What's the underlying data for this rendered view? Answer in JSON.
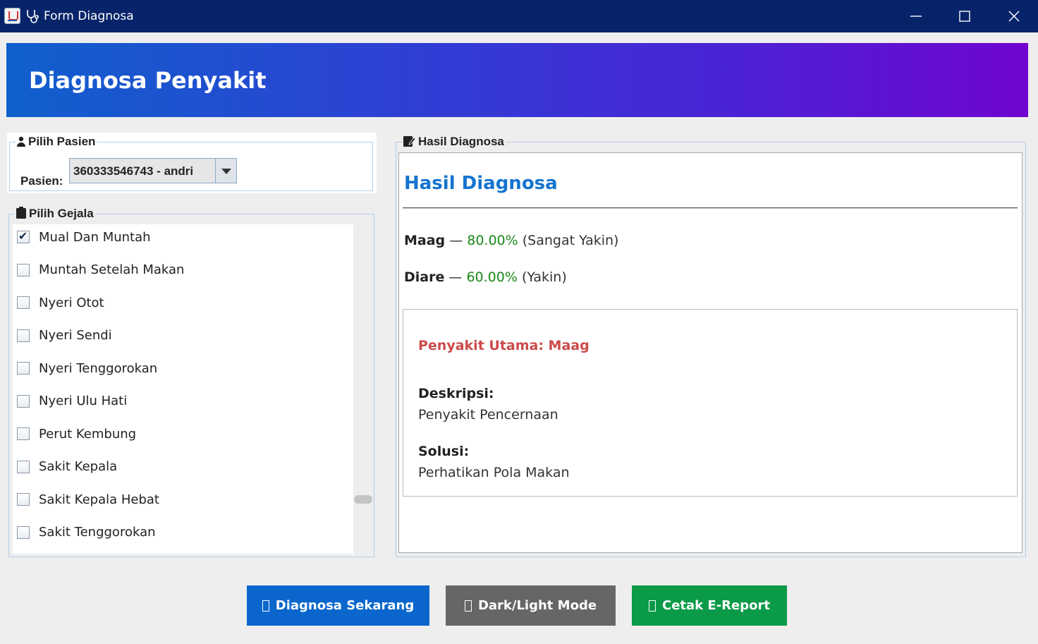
{
  "window": {
    "title": "Form Diagnosa",
    "icons": [
      "java-app-icon",
      "stethoscope-icon"
    ],
    "controls": [
      "minimize-icon",
      "maximize-icon",
      "close-icon"
    ]
  },
  "header": {
    "title": "Diagnosa Penyakit"
  },
  "pasien": {
    "group_title": "Pilih Pasien",
    "label": "Pasien:",
    "selected": "360333546743 - andri",
    "icon": "person-icon"
  },
  "gejala": {
    "group_title": "Pilih Gejala",
    "icon": "clipboard-icon",
    "items": [
      {
        "label": "Mual Dan Muntah",
        "checked": true
      },
      {
        "label": "Muntah Setelah Makan",
        "checked": false
      },
      {
        "label": "Nyeri Otot",
        "checked": false
      },
      {
        "label": "Nyeri Sendi",
        "checked": false
      },
      {
        "label": "Nyeri Tenggorokan",
        "checked": false
      },
      {
        "label": "Nyeri Ulu Hati",
        "checked": false
      },
      {
        "label": "Perut Kembung",
        "checked": false
      },
      {
        "label": "Sakit Kepala",
        "checked": false
      },
      {
        "label": "Sakit Kepala Hebat",
        "checked": false
      },
      {
        "label": "Sakit Tenggorokan",
        "checked": false
      }
    ]
  },
  "hasil": {
    "group_title": "Hasil Diagnosa",
    "icon": "notepad-icon",
    "heading": "Hasil Diagnosa",
    "results": [
      {
        "name": "Maag",
        "sep": " — ",
        "pct": "80.00%",
        "level": " (Sangat Yakin)"
      },
      {
        "name": "Diare",
        "sep": " — ",
        "pct": "60.00%",
        "level": " (Yakin)"
      }
    ],
    "utama": "Penyakit Utama: Maag",
    "deskripsi_label": "Deskripsi:",
    "deskripsi": "Penyakit Pencernaan",
    "solusi_label": "Solusi:",
    "solusi": "Perhatikan Pola Makan"
  },
  "buttons": {
    "diagnosa": "Diagnosa Sekarang",
    "mode": "Dark/Light Mode",
    "cetak": "Cetak E-Report"
  },
  "colors": {
    "titlebar": "#072369",
    "accent_blue": "#0a66cc",
    "mode_gray": "#666666",
    "cetak_green": "#0a9a48",
    "percent_green": "#1a8a1a",
    "utama_red": "#cc4a4a",
    "heading_blue": "#1574cf"
  }
}
